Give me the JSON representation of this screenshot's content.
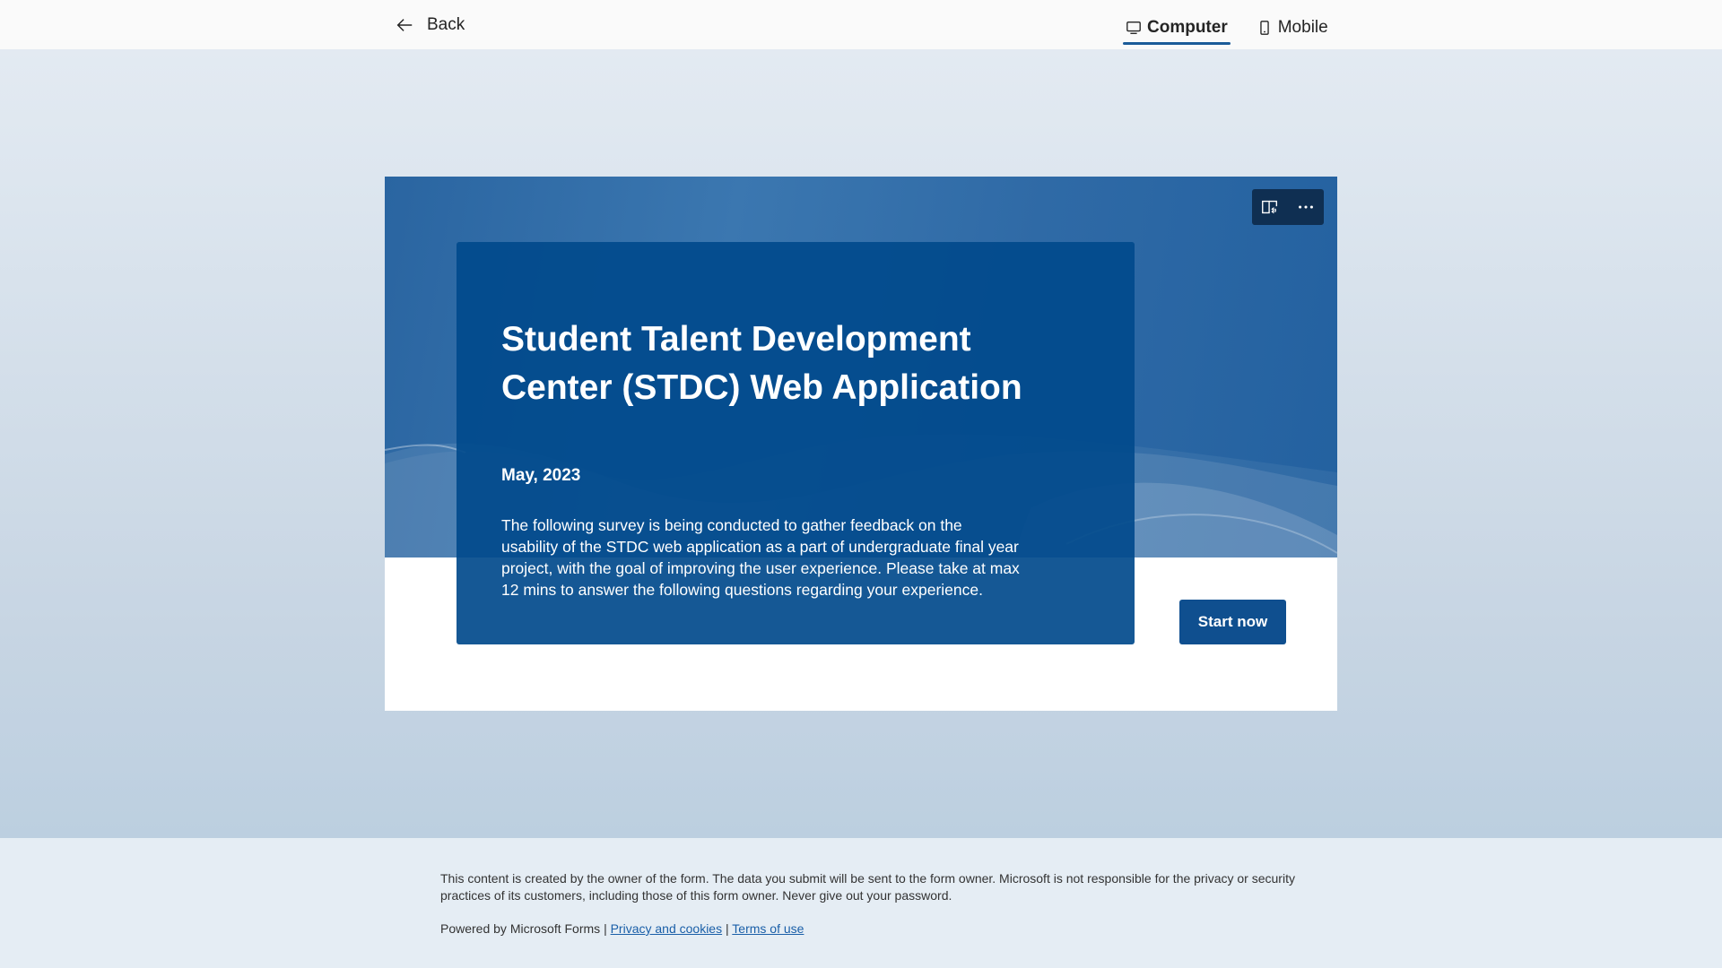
{
  "topbar": {
    "back_label": "Back",
    "views": [
      {
        "label": "Computer",
        "icon": "monitor-icon",
        "active": true
      },
      {
        "label": "Mobile",
        "icon": "phone-icon",
        "active": false
      }
    ]
  },
  "form": {
    "title": "Student Talent Development Center (STDC) Web Application",
    "date": "May, 2023",
    "description": "The following survey is being conducted to gather feedback on the usability of the STDC web application as a part of undergraduate final year project, with the goal of improving the user experience. Please take at max 12 mins to answer the following questions regarding your experience.",
    "start_label": "Start now",
    "tools": [
      "immersive-reader-icon",
      "more-options-icon"
    ]
  },
  "footer": {
    "disclaimer": "This content is created by the owner of the form. The data you submit will be sent to the form owner. Microsoft is not responsible for the privacy or security practices of its customers, including those of this form owner. Never give out your password.",
    "powered_by": "Powered by Microsoft Forms",
    "separator": "|",
    "privacy_link": "Privacy and cookies",
    "terms_link": "Terms of use"
  },
  "colors": {
    "banner": "#2a65a1",
    "info_box": "#014a8c",
    "start_button": "#0f4f8f",
    "link": "#1a5fa8"
  }
}
